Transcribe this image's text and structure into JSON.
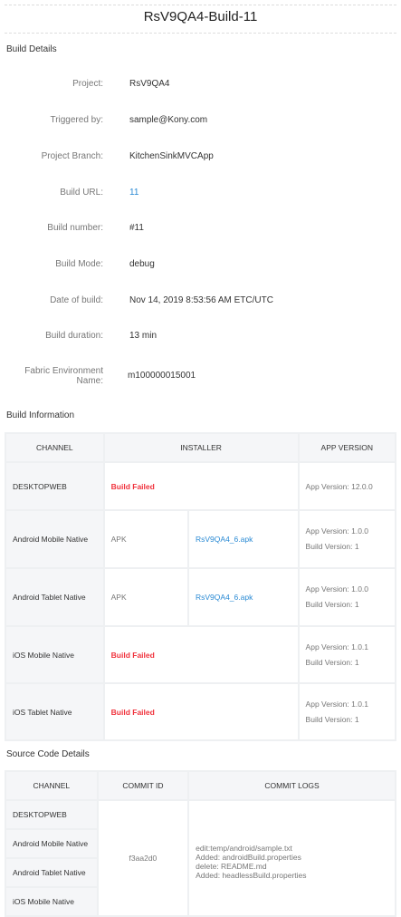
{
  "title": "RsV9QA4-Build-11",
  "build_details": {
    "heading": "Build Details",
    "rows": [
      {
        "label": "Project:",
        "value": "RsV9QA4"
      },
      {
        "label": "Triggered by:",
        "value": "sample@Kony.com"
      },
      {
        "label": "Project Branch:",
        "value": "KitchenSinkMVCApp"
      },
      {
        "label": "Build URL:",
        "value": "11"
      },
      {
        "label": "Build number:",
        "value": "#11"
      },
      {
        "label": "Build Mode:",
        "value": "debug"
      },
      {
        "label": "Date of build:",
        "value": "Nov 14, 2019 8:53:56 AM ETC/UTC"
      },
      {
        "label": "Build duration:",
        "value": "13 min"
      },
      {
        "label": "Fabric Environment Name:",
        "value": "m100000015001"
      }
    ]
  },
  "build_info": {
    "heading": "Build Information",
    "headers": [
      "CHANNEL",
      "INSTALLER",
      "APP VERSION"
    ],
    "rows": [
      {
        "channel": "DESKTOPWEB",
        "status": "Build Failed",
        "app_version": "App Version: 12.0.0"
      },
      {
        "channel": "Android Mobile Native",
        "type": "APK",
        "file": "RsV9QA4_6.apk",
        "app_version": "App Version: 1.0.0",
        "build_version": "Build Version: 1"
      },
      {
        "channel": "Android Tablet Native",
        "type": "APK",
        "file": "RsV9QA4_6.apk",
        "app_version": "App Version: 1.0.0",
        "build_version": "Build Version: 1"
      },
      {
        "channel": "iOS Mobile Native",
        "status": "Build Failed",
        "app_version": "App Version: 1.0.1",
        "build_version": "Build Version: 1"
      },
      {
        "channel": "iOS Tablet Native",
        "status": "Build Failed",
        "app_version": "App Version: 1.0.1",
        "build_version": "Build Version: 1"
      }
    ]
  },
  "source_code": {
    "heading": "Source Code Details",
    "headers": [
      "CHANNEL",
      "COMMIT ID",
      "COMMIT LOGS"
    ],
    "channels": [
      "DESKTOPWEB",
      "Android Mobile Native",
      "Android Tablet Native",
      "iOS Mobile Native"
    ],
    "commit_id": "f3aa2d0",
    "commit_logs": [
      "edit:temp/android/sample.txt",
      "Added: androidBuild.properties",
      "delete: README.md",
      "Added: headlessBuild.properties"
    ]
  },
  "colors": {
    "link": "#2a8ad4",
    "failed": "#f0323c"
  }
}
